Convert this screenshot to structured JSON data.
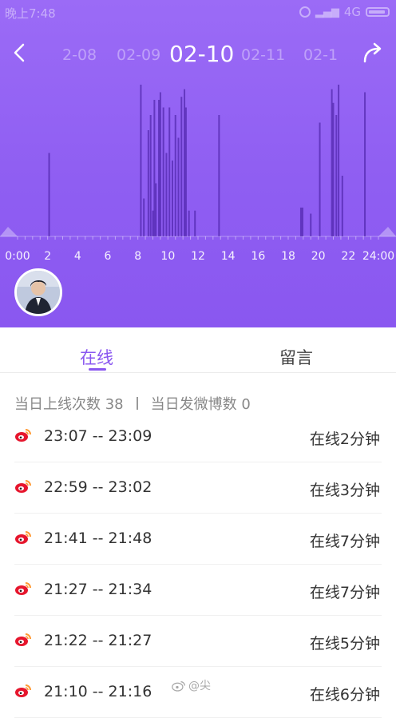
{
  "status_bar": {
    "time": "晚上7:48",
    "network": "4G"
  },
  "nav": {
    "dates": [
      "2-08",
      "02-09",
      "02-10",
      "02-11",
      "02-1"
    ],
    "active_index": 2
  },
  "chart_data": {
    "type": "bar",
    "x_ticks": [
      "0:00",
      "2",
      "4",
      "6",
      "8",
      "10",
      "12",
      "14",
      "16",
      "18",
      "20",
      "22",
      "24:00"
    ],
    "xlim": [
      0,
      24
    ],
    "x": [
      2.1,
      8.2,
      8.4,
      8.7,
      8.85,
      9.0,
      9.1,
      9.2,
      9.4,
      9.5,
      9.7,
      9.9,
      10.1,
      10.3,
      10.5,
      10.7,
      10.9,
      11.1,
      11.2,
      11.4,
      11.8,
      13.4,
      18.9,
      19.5,
      20.1,
      20.9,
      21.0,
      21.2,
      21.35,
      21.6,
      23.1
    ],
    "values": [
      0.55,
      1.0,
      0.25,
      0.7,
      0.8,
      0.17,
      0.9,
      0.35,
      0.9,
      0.95,
      0.85,
      0.55,
      0.85,
      0.5,
      0.8,
      0.65,
      0.92,
      0.97,
      0.85,
      0.17,
      0.17,
      0.8,
      0.19,
      0.15,
      0.75,
      0.97,
      0.88,
      0.8,
      1.0,
      0.4,
      0.95
    ]
  },
  "tabs": {
    "online": "在线",
    "messages": "留言"
  },
  "summary": {
    "online_count": "当日上线次数 38",
    "post_count": "当日发微博数 0"
  },
  "sessions": [
    {
      "range": "23:07 -- 23:09",
      "duration": "在线2分钟"
    },
    {
      "range": "22:59 -- 23:02",
      "duration": "在线3分钟"
    },
    {
      "range": "21:41 -- 21:48",
      "duration": "在线7分钟"
    },
    {
      "range": "21:27 -- 21:34",
      "duration": "在线7分钟"
    },
    {
      "range": "21:22 -- 21:27",
      "duration": "在线5分钟"
    },
    {
      "range": "21:10 -- 21:16",
      "duration": "在线6分钟"
    }
  ],
  "watermark": "@尖"
}
